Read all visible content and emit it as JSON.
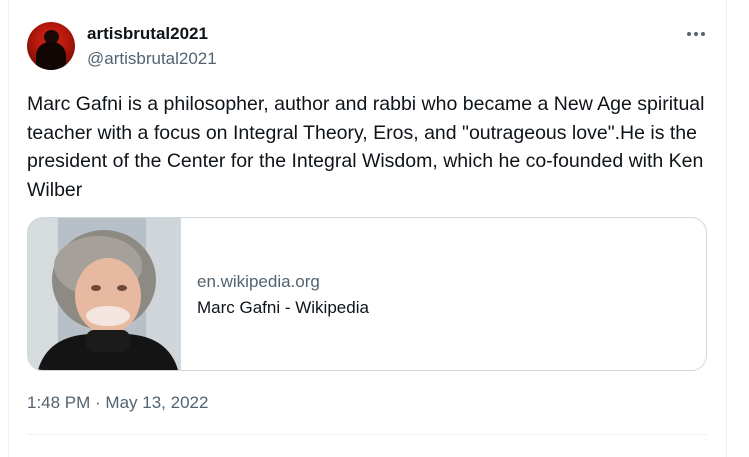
{
  "author": {
    "display_name": "artisbrutal2021",
    "handle": "@artisbrutal2021"
  },
  "tweet": {
    "text": "Marc Gafni is a philosopher, author and rabbi who became a New Age spiritual teacher with a focus on Integral Theory, Eros, and \"outrageous love\".He is the president of the Center for the Integral Wisdom, which he co-founded with Ken Wilber",
    "timestamp": "1:48 PM · May 13, 2022"
  },
  "link_card": {
    "domain": "en.wikipedia.org",
    "title": "Marc Gafni - Wikipedia"
  },
  "icons": {
    "more": "more-options-icon"
  },
  "colors": {
    "text": "#0f1419",
    "secondary": "#536471",
    "border": "#cfd9de"
  }
}
